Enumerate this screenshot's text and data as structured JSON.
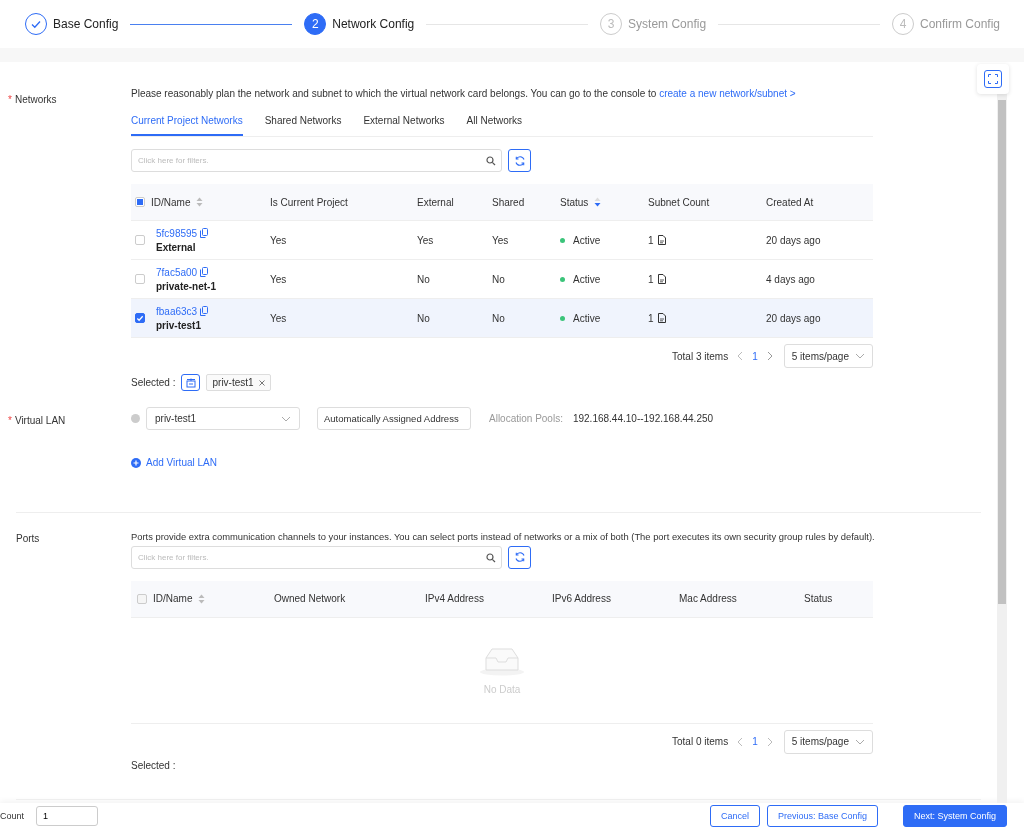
{
  "steps": [
    {
      "label": "Base Config",
      "done": true,
      "active": false
    },
    {
      "number": "2",
      "label": "Network Config",
      "done": false,
      "active": true
    },
    {
      "number": "3",
      "label": "System Config",
      "done": false,
      "active": false
    },
    {
      "number": "4",
      "label": "Confirm Config",
      "done": false,
      "active": false
    }
  ],
  "networks": {
    "label": "Networks",
    "required_mark": "*",
    "intro": "Please reasonably plan the network and subnet to which the virtual network card belongs. You can go to the console to ",
    "link": "create a new network/subnet >",
    "tabs": [
      {
        "label": "Current Project Networks",
        "selected": true
      },
      {
        "label": "Shared Networks",
        "selected": false
      },
      {
        "label": "External Networks",
        "selected": false
      },
      {
        "label": "All Networks",
        "selected": false
      }
    ],
    "filter": {
      "placeholder": "Click here for filters."
    },
    "select_all_partial": true,
    "columns": [
      {
        "label": "ID/Name",
        "sortable": true,
        "sorted_desc": false
      },
      {
        "label": "Is Current Project",
        "sortable": false,
        "sorted_desc": false
      },
      {
        "label": "External",
        "sortable": false,
        "sorted_desc": false
      },
      {
        "label": "Shared",
        "sortable": false,
        "sorted_desc": false
      },
      {
        "label": "Status",
        "sortable": true,
        "sorted_desc": true
      },
      {
        "label": "Subnet Count",
        "sortable": false,
        "sorted_desc": false
      },
      {
        "label": "Created At",
        "sortable": false,
        "sorted_desc": false
      }
    ],
    "rows": [
      {
        "id": "5fc98595",
        "name": "External",
        "current": "Yes",
        "external": "Yes",
        "shared": "Yes",
        "status": "Active",
        "subnets": "1",
        "created": "20 days ago",
        "selected": false
      },
      {
        "id": "7fac5a00",
        "name": "private-net-1",
        "current": "Yes",
        "external": "No",
        "shared": "No",
        "status": "Active",
        "subnets": "1",
        "created": "4 days ago",
        "selected": false
      },
      {
        "id": "fbaa63c3",
        "name": "priv-test1",
        "current": "Yes",
        "external": "No",
        "shared": "No",
        "status": "Active",
        "subnets": "1",
        "created": "20 days ago",
        "selected": true
      }
    ],
    "pagination": {
      "total": "Total 3 items",
      "page": "1",
      "page_size": "5 items/page"
    },
    "selected_label": "Selected :",
    "selected_tags": [
      "priv-test1"
    ]
  },
  "virtual_lan": {
    "label": "Virtual LAN",
    "required_mark": "*",
    "network": "priv-test1",
    "address": "Automatically Assigned Address",
    "pools_label": "Allocation Pools:",
    "pools": "192.168.44.10--192.168.44.250",
    "add": "Add Virtual LAN"
  },
  "ports": {
    "label": "Ports",
    "intro": "Ports provide extra communication channels to your instances. You can select ports instead of networks or a mix of both (The port executes its own security group rules by default).",
    "filter": {
      "placeholder": "Click here for filters."
    },
    "select_all_partial": false,
    "columns": [
      {
        "label": "ID/Name",
        "sortable": true,
        "sorted_desc": false
      },
      {
        "label": "Owned Network",
        "sortable": false,
        "sorted_desc": false
      },
      {
        "label": "IPv4 Address",
        "sortable": false,
        "sorted_desc": false
      },
      {
        "label": "IPv6 Address",
        "sortable": false,
        "sorted_desc": false
      },
      {
        "label": "Mac Address",
        "sortable": false,
        "sorted_desc": false
      },
      {
        "label": "Status",
        "sortable": false,
        "sorted_desc": false
      }
    ],
    "empty": "No Data",
    "pagination": {
      "total": "Total 0 items",
      "page": "1",
      "page_size": "5 items/page"
    },
    "selected_label": "Selected :"
  },
  "footer": {
    "count_label": "Count",
    "count": "1",
    "buttons": [
      {
        "label": "Cancel",
        "kind": "outline"
      },
      {
        "label": "Previous: Base Config",
        "kind": "outline"
      },
      {
        "label": "Next: System Config",
        "kind": "primary"
      }
    ]
  }
}
